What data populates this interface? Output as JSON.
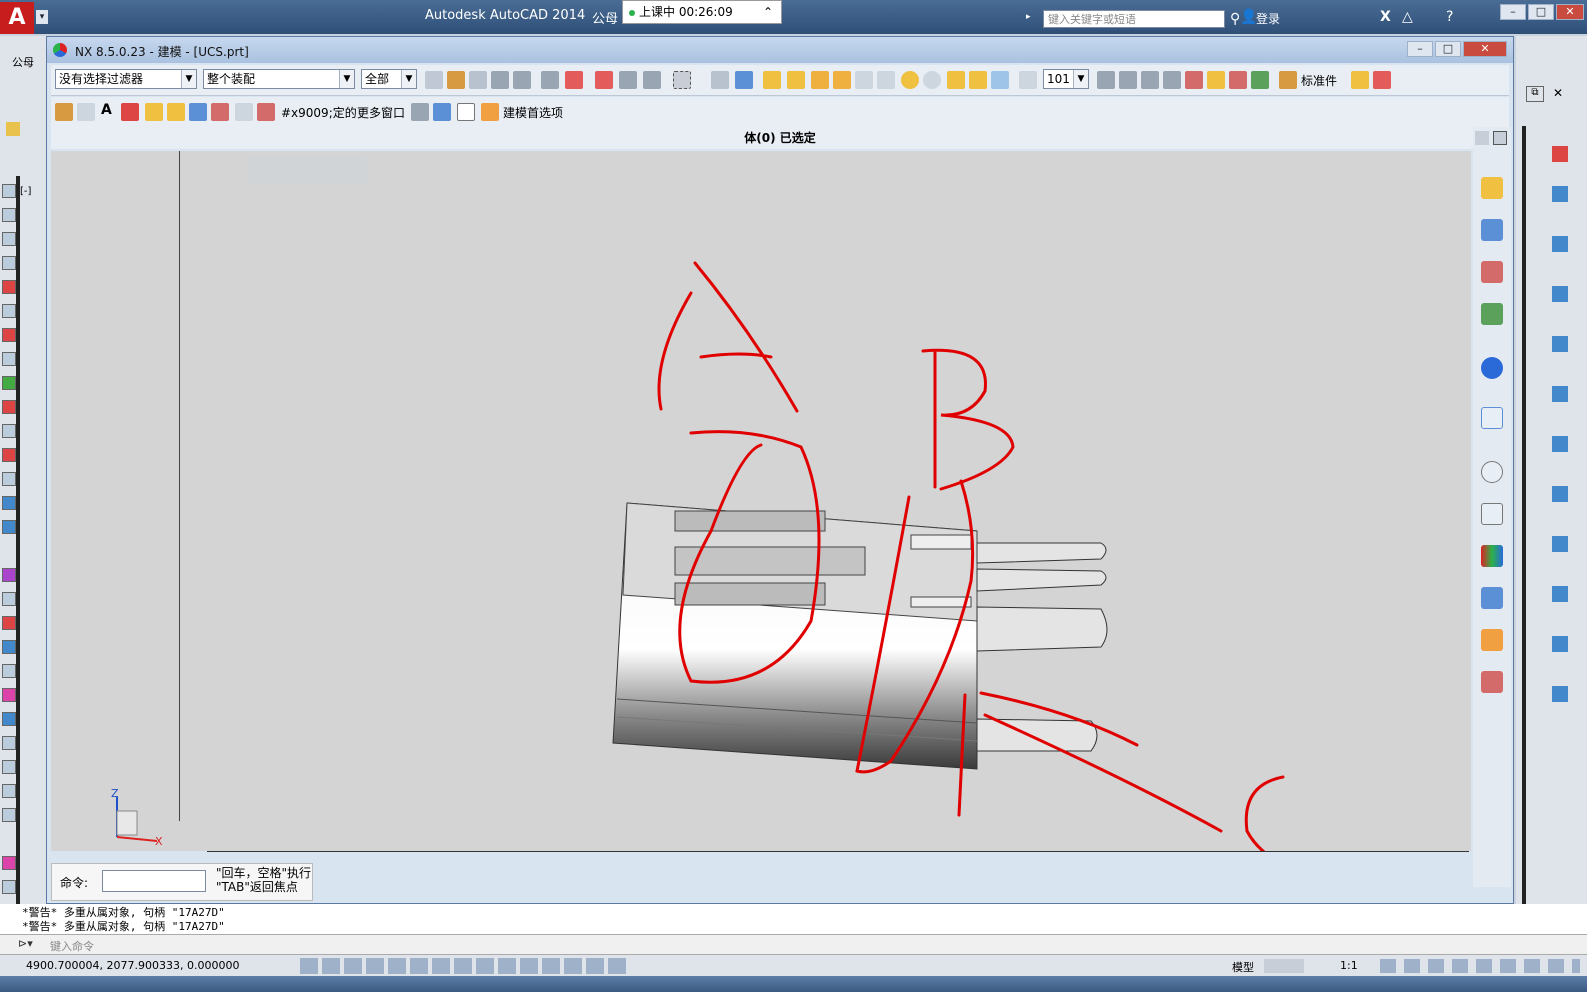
{
  "autocad": {
    "title": "Autodesk AutoCAD 2014",
    "title_extra": "公母",
    "class_timer": "上课中 00:26:09",
    "search_placeholder": "键入关键字或短语",
    "login": "登录",
    "coords": "4900.700004,  2077.900333, 0.000000",
    "history_line1": "*警告* 多重从属对象, 句柄 \"17A27D\"",
    "history_line2": "*警告* 多重从属对象, 句柄 \"17A27D\"",
    "cmd_placeholder": "键入命令",
    "model_tab": "模型",
    "scale": "1:1",
    "tab_label": "公母"
  },
  "nx": {
    "title": "NX 8.5.0.23 - 建模 - [UCS.prt]",
    "filter_select": "没有选择过滤器",
    "assembly_select": "整个装配",
    "all_select": "全部",
    "layer_value": "101",
    "standard_parts": "标准件",
    "xnote": "#x9009;定的",
    "more_windows": "更多窗口",
    "modeling_prefs": "建模首选项",
    "status": "体(0) 已选定",
    "cmd_label": "命令:",
    "cmd_hint_line1": "\"回车，空格\"执行",
    "cmd_hint_line2": "\"TAB\"返回焦点",
    "axis_z": "Z",
    "axis_x": "X"
  },
  "annotations": {
    "letters": [
      "A",
      "B",
      "C"
    ],
    "color": "#e00000"
  },
  "colors": {
    "acad_title": "#2f4f77",
    "nx_window": "#d9e4f1",
    "viewport": "#d4d4d4"
  }
}
